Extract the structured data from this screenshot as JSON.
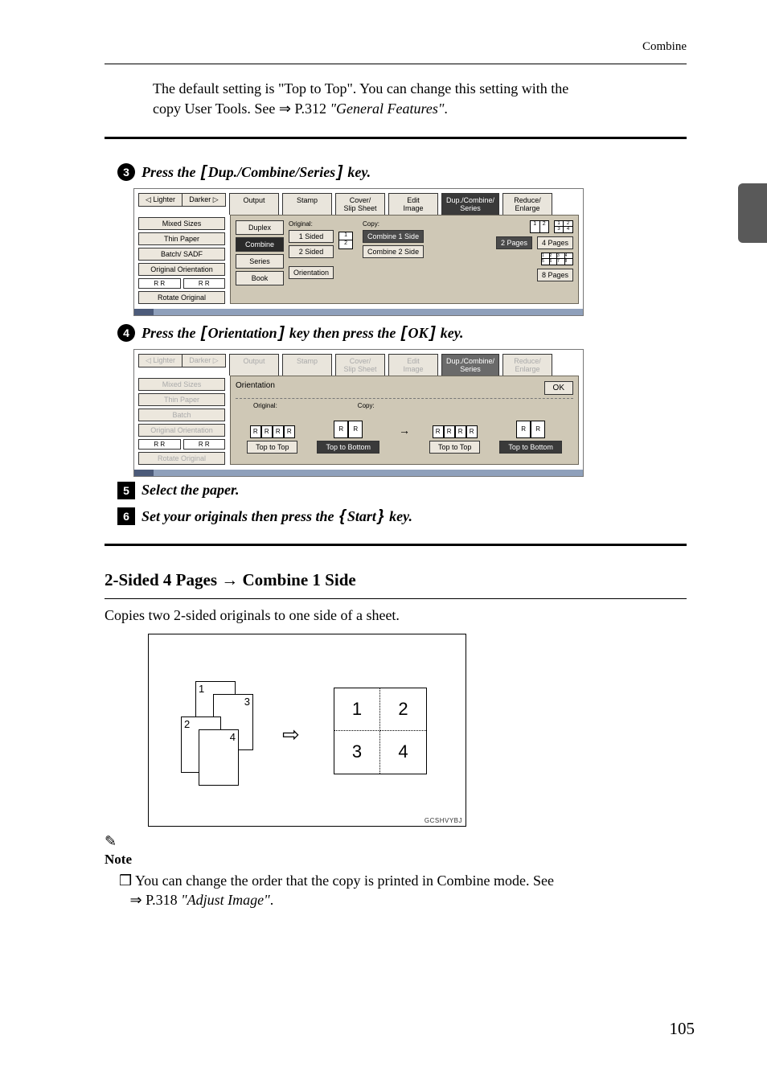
{
  "page_number": "105",
  "header": "Combine",
  "intro": {
    "line1_prefix": "The default setting is \"Top to Top\". You can change this setting with the",
    "line2_prefix": "copy User Tools. See ",
    "arrow": "⇒ ",
    "line2_link": "P.312 ",
    "line2_ital": "\"General Features\"",
    "period": "."
  },
  "step3": {
    "num": "3",
    "prefix": "Press the ",
    "bracket_text": "Dup./Combine/Series",
    "suffix": " key."
  },
  "shot1": {
    "lighter": "Lighter",
    "darker": "Darker",
    "tabs": [
      "Output",
      "Stamp",
      "Cover/\nSlip Sheet",
      "Edit\nImage",
      "Dup./Combine/\nSeries",
      "Reduce/\nEnlarge"
    ],
    "left": [
      "Mixed Sizes",
      "Thin Paper",
      "Batch/ SADF",
      "Original Orientation",
      "Rotate Original"
    ],
    "duplex": "Duplex",
    "combine": "Combine",
    "series": "Series",
    "book": "Book",
    "original_label": "Original:",
    "one_sided": "1 Sided",
    "two_sided": "2 Sided",
    "orientation": "Orientation",
    "copy_label": "Copy:",
    "c1s": "Combine 1 Side",
    "c2s": "Combine 2 Side",
    "pages2": "2 Pages",
    "pages4": "4 Pages",
    "pages8": "8 Pages"
  },
  "step4": {
    "num": "4",
    "prefix": "Press the ",
    "bracket_text": "Orientation",
    "mid": " key then press the ",
    "bracket2": "OK",
    "suffix": " key."
  },
  "shot2": {
    "orientation": "Orientation",
    "ok": "OK",
    "orig": "Original:",
    "copy": "Copy:",
    "ttt": "Top to Top",
    "ttb": "Top to Bottom"
  },
  "step5": {
    "num": "5",
    "text": "Select the paper."
  },
  "step6": {
    "num": "6",
    "prefix": "Set your originals then press the ",
    "bracket_text": "Start",
    "suffix": " key."
  },
  "section": {
    "title": "2-Sided 4 Pages → Combine 1 Side",
    "desc": "Copies two 2-sided originals to one side of a sheet."
  },
  "diag": {
    "s1": "1",
    "s3": "3",
    "s2": "2",
    "s4": "4",
    "arrow": "⇨",
    "g": [
      "1",
      "2",
      "3",
      "4"
    ],
    "code": "GCSHVYBJ"
  },
  "note": {
    "label": "Note",
    "line1": "You can change the order that the copy is printed in Combine mode. See ",
    "arrow": "⇒",
    "link": "P.318 ",
    "ital": "\"Adjust Image\"",
    "period": "."
  }
}
